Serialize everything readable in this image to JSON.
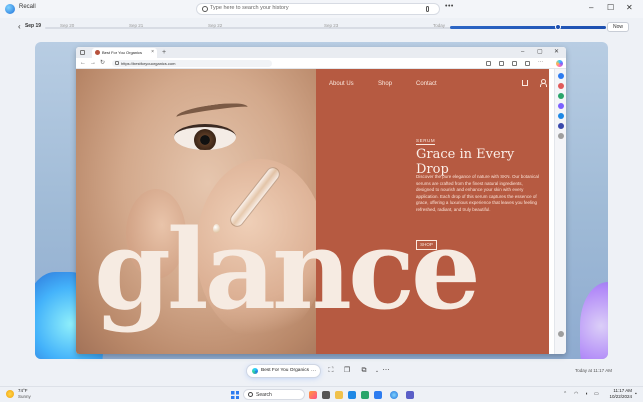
{
  "app": {
    "title": "Recall"
  },
  "search": {
    "placeholder": "Type here to search your history"
  },
  "window_controls": {
    "minimize": "–",
    "maximize": "☐",
    "close": "✕"
  },
  "timeline": {
    "current_date": "Sep 19",
    "labels": [
      "Sep 20",
      "Sep 21",
      "Sep 22",
      "Sep 23",
      "Today"
    ],
    "now_button": "Now",
    "position": 0.925
  },
  "browser": {
    "tab_title": "Best For You Organics",
    "url": "https://bestforyouorganics.com",
    "page": {
      "menu": [
        "About Us",
        "Shop",
        "Contact"
      ],
      "kicker": "SERUM",
      "headline": "Grace in Every Drop",
      "body": "Discover the pure elegance of nature with SKN. Our botanical serums are crafted from the finest natural ingredients, designed to nourish and enhance your skin with every application. Each drop of this serum captures the essence of grace, offering a luxurious experience that leaves you feeling refreshed, radiant, and truly beautiful.",
      "shop_button": "SHOP",
      "big_word": "glance"
    }
  },
  "bottom_bar": {
    "app_pill_label": "Best For You Organics",
    "timestamp": "Today at 11:17 AM"
  },
  "taskbar": {
    "weather_temp": "74°F",
    "weather_condition": "Sunny",
    "search_label": "Search",
    "time": "11:17 AM",
    "date": "10/22/2024"
  }
}
